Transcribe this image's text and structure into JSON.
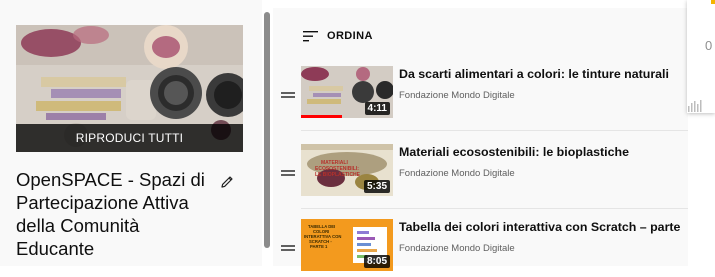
{
  "playlist": {
    "play_all_label": "RIPRODUCI TUTTI",
    "title": "OpenSPACE - Spazi di Partecipazione Attiva della Comunità Educante"
  },
  "list": {
    "sort_label": "ORDINA",
    "videos": [
      {
        "title": "Da scarti alimentari a colori: le tinture naturali",
        "channel": "Fondazione Mondo Digitale",
        "duration": "4:11",
        "watched_fraction": 0.45
      },
      {
        "title": "Materiali ecosostenibili: le bioplastiche",
        "channel": "Fondazione Mondo Digitale",
        "duration": "5:35",
        "thumb_text": "MATERIALI ECOSOSTENIBILI: LE BIOPLASTICHE"
      },
      {
        "title": "Tabella dei colori interattiva con Scratch – parte 1",
        "channel": "Fondazione Mondo Digitale",
        "duration": "8:05",
        "thumb_text": "TABELLA DEI COLORI INTERATTIVA CON SCRATCH - PARTE 1"
      }
    ]
  },
  "side_card": {
    "digit": "0"
  },
  "icons": {
    "sort": "sort-icon",
    "edit": "pencil-icon",
    "drag": "drag-handle-icon"
  },
  "colors": {
    "progress": "#ff0000",
    "panel_bg": "#f9f9f9",
    "scrollbar": "#8c8c8c"
  }
}
